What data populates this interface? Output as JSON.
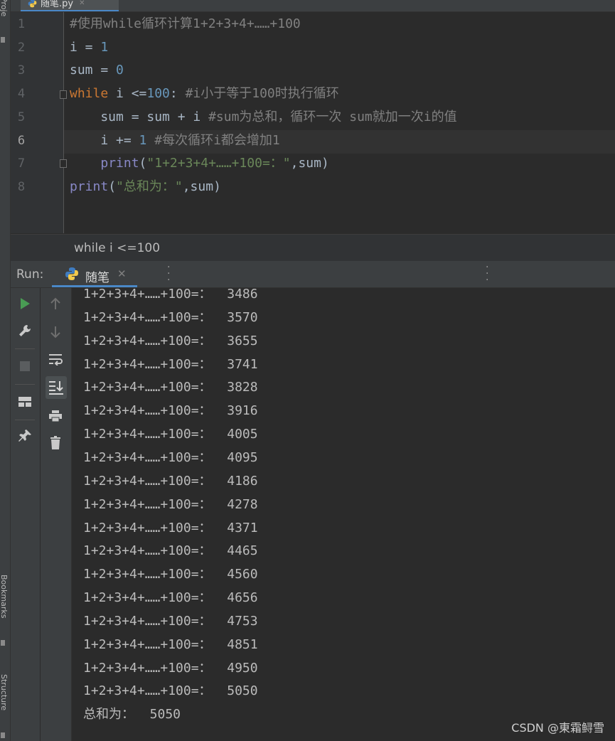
{
  "editor": {
    "file_tab": "随笔.py",
    "lines": [
      {
        "num": "1",
        "tokens": [
          {
            "t": "#使用while循环计算1+2+3+4+……+100",
            "c": "cmt"
          }
        ]
      },
      {
        "num": "2",
        "tokens": [
          {
            "t": "i = ",
            "c": ""
          },
          {
            "t": "1",
            "c": "num"
          }
        ]
      },
      {
        "num": "3",
        "tokens": [
          {
            "t": "sum = ",
            "c": ""
          },
          {
            "t": "0",
            "c": "num"
          }
        ]
      },
      {
        "num": "4",
        "tokens": [
          {
            "t": "while",
            "c": "kw"
          },
          {
            "t": " i <=",
            "c": ""
          },
          {
            "t": "100",
            "c": "num"
          },
          {
            "t": ": ",
            "c": ""
          },
          {
            "t": "#i小于等于100时执行循环",
            "c": "cmt"
          }
        ]
      },
      {
        "num": "5",
        "tokens": [
          {
            "t": "    sum = sum + i ",
            "c": ""
          },
          {
            "t": "#sum为总和，循环一次 sum就加一次i的值",
            "c": "cmt"
          }
        ]
      },
      {
        "num": "6",
        "tokens": [
          {
            "t": "    i += ",
            "c": ""
          },
          {
            "t": "1",
            "c": "num"
          },
          {
            "t": " ",
            "c": ""
          },
          {
            "t": "#每次循环i都会增加1",
            "c": "cmt"
          }
        ]
      },
      {
        "num": "7",
        "tokens": [
          {
            "t": "    ",
            "c": ""
          },
          {
            "t": "print",
            "c": "bi"
          },
          {
            "t": "(",
            "c": ""
          },
          {
            "t": "\"1+2+3+4+……+100=：\"",
            "c": "str"
          },
          {
            "t": ",sum)",
            "c": ""
          }
        ]
      },
      {
        "num": "8",
        "tokens": [
          {
            "t": "print",
            "c": "bi"
          },
          {
            "t": "(",
            "c": ""
          },
          {
            "t": "\"总和为：\"",
            "c": "str"
          },
          {
            "t": ",sum)",
            "c": ""
          }
        ]
      }
    ],
    "current_line": "6"
  },
  "breadcrumb": "while i <=100",
  "run": {
    "label": "Run:",
    "tab_label": "随笔"
  },
  "console": {
    "lines": [
      "1+2+3+4+……+100=：  3486",
      "1+2+3+4+……+100=：  3570",
      "1+2+3+4+……+100=：  3655",
      "1+2+3+4+……+100=：  3741",
      "1+2+3+4+……+100=：  3828",
      "1+2+3+4+……+100=：  3916",
      "1+2+3+4+……+100=：  4005",
      "1+2+3+4+……+100=：  4095",
      "1+2+3+4+……+100=：  4186",
      "1+2+3+4+……+100=：  4278",
      "1+2+3+4+……+100=：  4371",
      "1+2+3+4+……+100=：  4465",
      "1+2+3+4+……+100=：  4560",
      "1+2+3+4+……+100=：  4656",
      "1+2+3+4+……+100=：  4753",
      "1+2+3+4+……+100=：  4851",
      "1+2+3+4+……+100=：  4950",
      "1+2+3+4+……+100=：  5050",
      "总和为：  5050"
    ]
  },
  "side_panels": {
    "project": "Proje",
    "bookmarks": "Bookmarks",
    "structure": "Structure"
  },
  "watermark": "CSDN @東霜鲟雪",
  "icons": {
    "run": "run-icon",
    "wrench": "wrench-icon",
    "stop": "stop-icon",
    "layout": "layout-icon",
    "pin": "pin-icon",
    "up": "arrow-up-icon",
    "down": "arrow-down-icon",
    "wrap": "soft-wrap-icon",
    "scroll": "scroll-to-end-icon",
    "print": "print-icon",
    "trash": "trash-icon"
  },
  "colors": {
    "keyword": "#cc7832",
    "comment": "#808080",
    "number": "#6897bb",
    "string": "#6a8759",
    "builtin": "#8888c6",
    "run_green": "#499c54",
    "accent": "#4a88c7"
  }
}
